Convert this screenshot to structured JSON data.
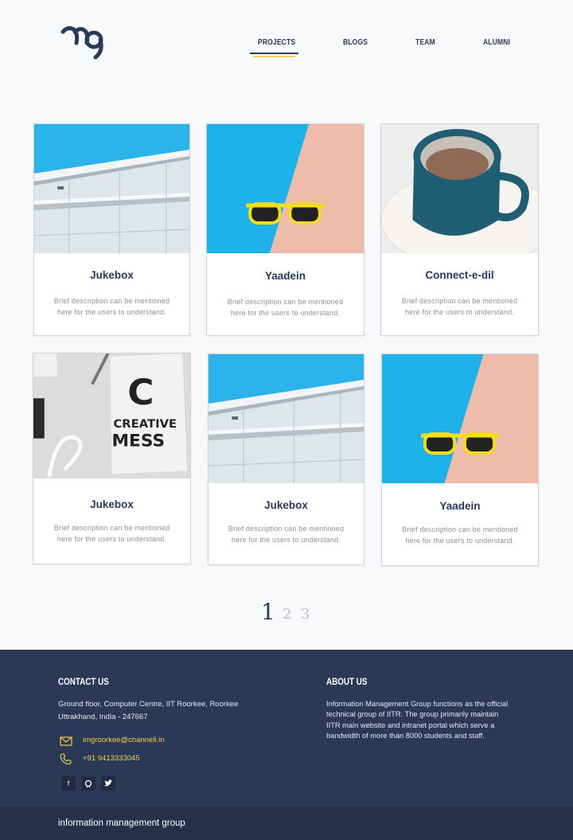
{
  "nav": {
    "items": [
      {
        "label": "PROJECTS",
        "active": true
      },
      {
        "label": "BLOGS",
        "active": false
      },
      {
        "label": "TEAM",
        "active": false
      },
      {
        "label": "ALUMNI",
        "active": false
      }
    ]
  },
  "cards": [
    {
      "title": "Jukebox",
      "description": "Brief description can be mentioned here for the users to understand.",
      "image": "building"
    },
    {
      "title": "Yaadein",
      "description": "Brief description can be mentioned here for the users to understand.",
      "image": "sunglasses"
    },
    {
      "title": "Connect-e-dil",
      "description": "Brief description can be mentioned here for the users to understand.",
      "image": "coffee"
    },
    {
      "title": "Jukebox",
      "description": "Brief description can be mentioned here for the users to understand.",
      "image": "creative-mess"
    },
    {
      "title": "Jukebox",
      "description": "Brief description can be mentioned here for the users to understand.",
      "image": "building"
    },
    {
      "title": "Yaadein",
      "description": "Brief description can be mentioned here for the users to understand.",
      "image": "sunglasses"
    }
  ],
  "pagination": {
    "pages": [
      "1",
      "2",
      "3"
    ],
    "current": "1"
  },
  "footer": {
    "contact_heading": "CONTACT US",
    "address_line1": "Ground floor, Computer Centre, IIT Roorkee, Roorkee",
    "address_line2": "Uttrakhand, India - 247667",
    "email": "imgroorkee@channeli.in",
    "phone": "+91 9413333045",
    "social": [
      "facebook-icon",
      "github-icon",
      "twitter-icon"
    ],
    "about_heading": "ABOUT US",
    "about_lines": [
      "Information Management Group functions as the official",
      "technical group of IITR. The group primarily maintain",
      "IITR main website and intranet portal which serve a",
      "bandwidth of more than 8000 students and staff."
    ],
    "brand": "information management group"
  },
  "colors": {
    "primary": "#2a3a57",
    "accent": "#f5d25b",
    "footer_bg": "#2a3a56"
  }
}
